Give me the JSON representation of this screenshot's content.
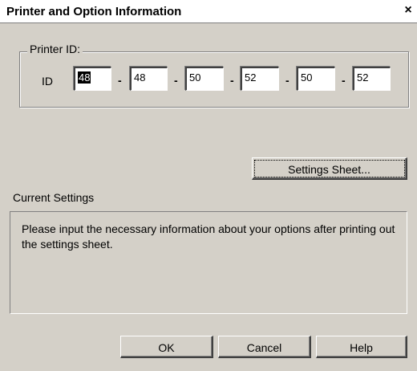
{
  "window": {
    "title": "Printer and Option Information",
    "close_label": "×"
  },
  "printer_id": {
    "group_label": "Printer ID:",
    "id_label": "ID",
    "fields": [
      "48",
      "48",
      "50",
      "52",
      "50",
      "52"
    ],
    "separator": "-"
  },
  "buttons": {
    "settings_sheet": "Settings Sheet...",
    "ok": "OK",
    "cancel": "Cancel",
    "help": "Help"
  },
  "current_settings": {
    "label": "Current Settings",
    "message": "Please input the necessary information about your options after printing out the settings sheet."
  }
}
